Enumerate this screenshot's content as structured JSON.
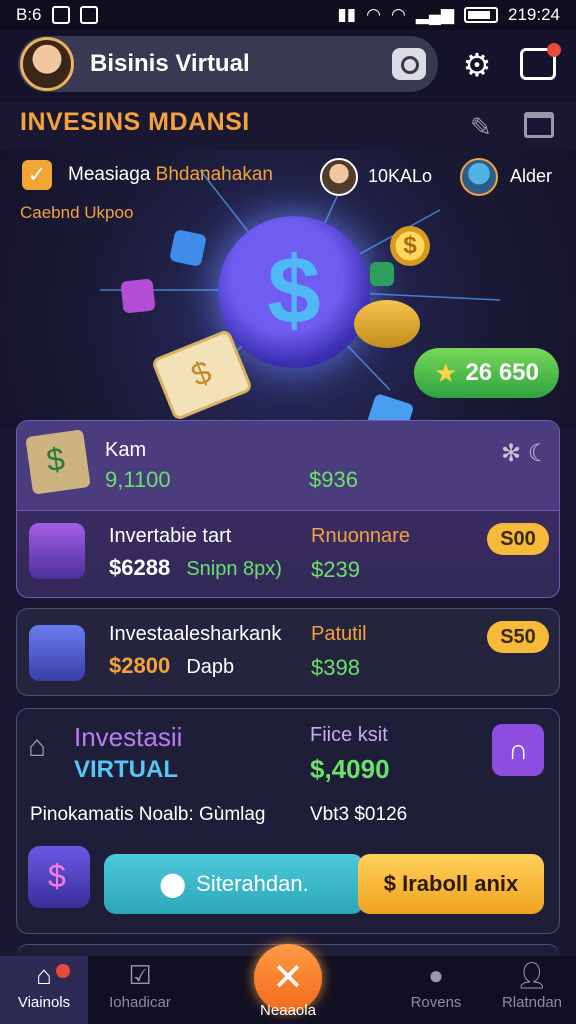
{
  "status_bar": {
    "time_left": "B:6",
    "time_right": "219:24"
  },
  "header": {
    "title": "Bisinis Virtual",
    "icons": [
      "camera-icon",
      "gear-icon",
      "chat-icon"
    ]
  },
  "section": {
    "title": "INVESINS MDANSI"
  },
  "activity": {
    "message_prefix": "Measiaga",
    "message_accent": "Bhdanahakan",
    "sub_text": "Caebnd Ukpoo",
    "right_label_1": "10KALo",
    "right_label_2": "Alder"
  },
  "score": {
    "value": "26 650"
  },
  "card_kam": {
    "label": "Kam",
    "value": "9,1100",
    "right_value": "$936"
  },
  "inv_row_1": {
    "title": "Invertabie tart",
    "value": "$6288",
    "value_note": "Snipn 8px)",
    "right_label": "Rnuonnare",
    "right_value": "$239",
    "price": "S00"
  },
  "inv_row_2": {
    "title": "Investaalesharkank",
    "value": "$2800",
    "value_note": "Dapb",
    "right_label": "Patutil",
    "right_value": "$398",
    "price": "S50"
  },
  "virtual_card": {
    "title_line_1": "Investasii",
    "title_line_2": "VIRTUAL",
    "right_label": "Fiice ksit",
    "right_value": "$,4090",
    "line_left": "Pinokamatis Noalb: Gùmlag",
    "line_right": "Vbt3 $0126",
    "primary_btn": "Siterahdan.",
    "secondary_btn": "$ Iraboll anix"
  },
  "nav": {
    "items": [
      {
        "label": "Viainols",
        "icon": "home-icon"
      },
      {
        "label": "Iohadicar",
        "icon": "check-icon"
      },
      {
        "label": "Neaaola",
        "icon": "close-icon"
      },
      {
        "label": "Rovens",
        "icon": "user-icon"
      },
      {
        "label": "Rlatndan",
        "icon": "profile-icon"
      }
    ]
  },
  "colors": {
    "accent_orange": "#f3a23c",
    "accent_green": "#6be06b",
    "accent_cyan": "#4cc8da",
    "accent_purple": "#8d4ee0",
    "background": "#1a1733"
  }
}
